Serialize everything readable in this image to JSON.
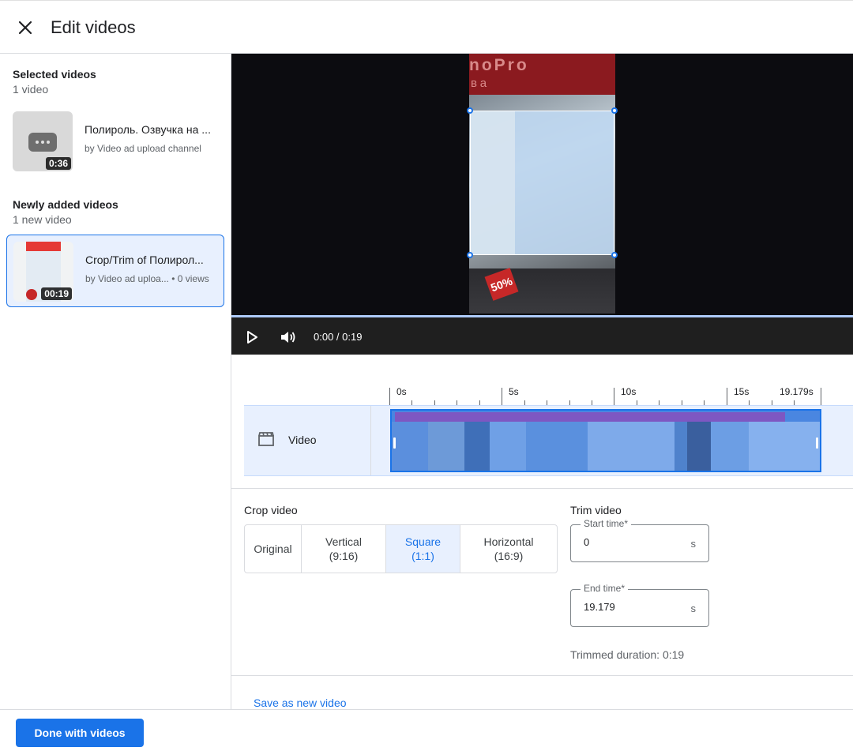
{
  "header": {
    "title": "Edit videos",
    "close_icon": "close-icon"
  },
  "sidebar": {
    "selected_section": {
      "title": "Selected videos",
      "count": "1 video"
    },
    "selected_videos": [
      {
        "title": "Полироль. Озвучка на ...",
        "meta": "by Video ad upload channel",
        "duration": "0:36"
      }
    ],
    "new_section": {
      "title": "Newly added videos",
      "count": "1 new video"
    },
    "new_videos": [
      {
        "title": "Crop/Trim of Полирол...",
        "meta": "by Video ad uploa... • 0 views",
        "duration": "00:19"
      }
    ]
  },
  "player": {
    "time": "0:00 / 0:19",
    "overlay_text_top": "noPro",
    "overlay_text_sub": "ва",
    "badge_text": "50%",
    "play_icon": "play-icon",
    "volume_icon": "volume-icon"
  },
  "timeline": {
    "ticks": [
      "0s",
      "5s",
      "10s",
      "15s",
      "19.179s"
    ],
    "track_label": "Video",
    "track_icon": "clapperboard-icon"
  },
  "crop": {
    "title": "Crop video",
    "options": [
      {
        "line1": "Original",
        "line2": ""
      },
      {
        "line1": "Vertical",
        "line2": "(9:16)"
      },
      {
        "line1": "Square",
        "line2": "(1:1)"
      },
      {
        "line1": "Horizontal",
        "line2": "(16:9)"
      }
    ],
    "selected": "Square"
  },
  "trim": {
    "title": "Trim video",
    "start_label": "Start time*",
    "start_value": "0",
    "end_label": "End time*",
    "end_value": "19.179",
    "unit": "s",
    "duration": "Trimmed duration: 0:19"
  },
  "actions": {
    "save_label": "Save as new video",
    "done_label": "Done with videos"
  },
  "colors": {
    "accent": "#1a73e8",
    "selected_bg": "#e8f0fe",
    "audio_track": "#7e57c2"
  }
}
